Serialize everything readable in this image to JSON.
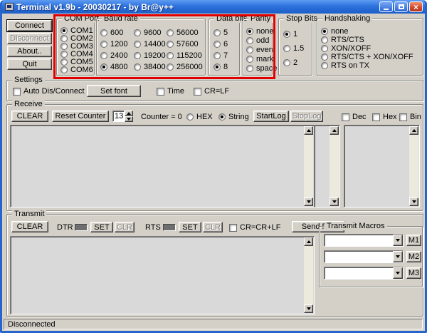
{
  "window": {
    "title": "Terminal v1.9b - 20030217 - by Br@y++"
  },
  "buttons": {
    "connect": "Connect",
    "disconnect": "Disconnect",
    "about": "About..",
    "quit": "Quit"
  },
  "groups": {
    "com_port": {
      "label": "COM Port",
      "options": [
        "COM1",
        "COM2",
        "COM3",
        "COM4",
        "COM5",
        "COM6"
      ],
      "selected": "COM1"
    },
    "baud_rate": {
      "label": "Baud rate",
      "options": [
        "600",
        "1200",
        "2400",
        "4800",
        "9600",
        "14400",
        "19200",
        "38400",
        "56000",
        "57600",
        "115200",
        "256000"
      ],
      "selected": "4800"
    },
    "data_bits": {
      "label": "Data bits",
      "options": [
        "5",
        "6",
        "7",
        "8"
      ],
      "selected": "8"
    },
    "parity": {
      "label": "Parity",
      "options": [
        "none",
        "odd",
        "even",
        "mark",
        "space"
      ],
      "selected": "none"
    },
    "stop_bits": {
      "label": "Stop Bits",
      "options": [
        "1",
        "1.5",
        "2"
      ],
      "selected": "1"
    },
    "handshaking": {
      "label": "Handshaking",
      "options": [
        "none",
        "RTS/CTS",
        "XON/XOFF",
        "RTS/CTS + XON/XOFF",
        "RTS on TX"
      ],
      "selected": "none"
    }
  },
  "settings": {
    "label": "Settings",
    "auto_dis_connect": "Auto Dis/Connect",
    "set_font": "Set font",
    "time": "Time",
    "cr_lf": "CR=LF"
  },
  "receive": {
    "label": "Receive",
    "clear": "CLEAR",
    "reset_counter": "Reset Counter",
    "spin_value": "13",
    "counter": "Counter = 0",
    "mode_hex": "HEX",
    "mode_string": "String",
    "selected_mode": "String",
    "start_log": "StartLog",
    "stop_log": "StopLog",
    "view_dec": "Dec",
    "view_hex": "Hex",
    "view_bin": "Bin"
  },
  "transmit": {
    "label": "Transmit",
    "clear": "CLEAR",
    "dtr": "DTR",
    "rts": "RTS",
    "set": "SET",
    "clr": "CLR",
    "cr_crlf": "CR=CR+LF",
    "send_file": "Send File",
    "macros": {
      "label": "Transmit Macros",
      "buttons": [
        "M1",
        "M2",
        "M3"
      ]
    }
  },
  "statusbar": {
    "text": "Disconnected"
  },
  "annotation": {
    "type": "red-rectangle-highlight",
    "covers": "COM Port, Baud rate, Data bits, Parity"
  },
  "colors": {
    "window_bg": "#d4d0c8",
    "titlebar_blue": "#2d72dd",
    "close_red": "#d6492f",
    "annotation_red": "#e10000",
    "text_area": "#d9d9d9"
  }
}
